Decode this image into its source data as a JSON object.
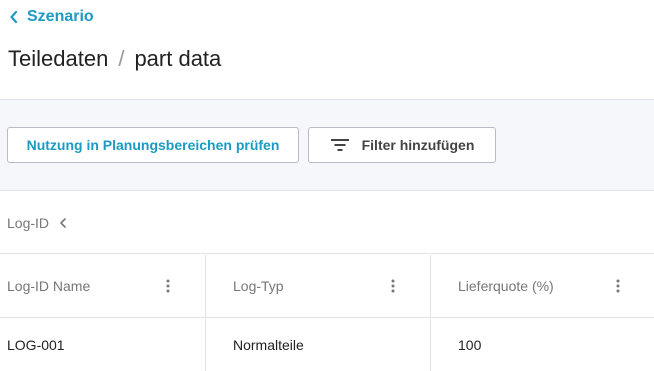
{
  "nav": {
    "back_label": "Szenario"
  },
  "title": {
    "main": "Teiledaten",
    "separator": "/",
    "sub": "part data"
  },
  "toolbar": {
    "usage_button": "Nutzung in Planungsbereichen prüfen",
    "filter_button": "Filter hinzufügen"
  },
  "group": {
    "label": "Log-ID"
  },
  "table": {
    "columns": [
      "Log-ID Name",
      "Log-Typ",
      "Lieferquote (%)"
    ],
    "rows": [
      [
        "LOG-001",
        "Normalteile",
        "100"
      ]
    ]
  },
  "colors": {
    "accent": "#1a9bc3",
    "border": "#dfe2ea",
    "toolbar_bg": "#f6f7fa"
  },
  "icons": {
    "back": "chevron-left-icon",
    "filter": "filter-icon",
    "collapse": "chevron-left-icon",
    "column_menu": "kebab-menu-icon"
  }
}
